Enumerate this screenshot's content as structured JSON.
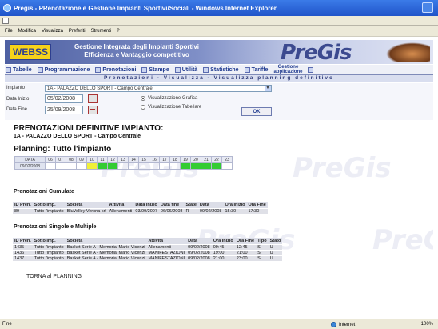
{
  "window": {
    "title": "Pregis - PRenotazione e Gestione Impianti Sportivi/Sociali - Windows Internet Explorer"
  },
  "menu": [
    "File",
    "Modifica",
    "Visualizza",
    "Preferiti",
    "Strumenti",
    "?"
  ],
  "banner": {
    "logo": "WEBSS",
    "line1": "Gestione Integrata degli Impianti Sportivi",
    "line2": "Efficienza e Vantaggio competitivo",
    "brand": "PreGis"
  },
  "toolbar": {
    "items": [
      "Tabelle",
      "Programmazione",
      "Prenotazioni",
      "Stampe",
      "Utilità",
      "Statistiche",
      "Tariffe"
    ],
    "gestione_line1": "Gestione",
    "gestione_line2": "applicazione"
  },
  "subtitle": "Prenotazioni - Visualizza - Visualizza planning definitivo",
  "form": {
    "impianto_label": "Impianto",
    "impianto_value": "1A - PALAZZO DELLO SPORT - Campo Centrale",
    "data_inizio_label": "Data Inizio",
    "data_inizio_value": "05/02/2008",
    "data_fine_label": "Data Fine",
    "data_fine_value": "25/09/2008",
    "radio_grafica": "Visualizzazione Grafica",
    "radio_tabellare": "Visualizzazione Tabellare",
    "ok": "OK"
  },
  "pane": {
    "title": "PRENOTAZIONI DEFINITIVE IMPIANTO:",
    "subtitle": "1A - PALAZZO DELLO SPORT - Campo Centrale",
    "planning_title": "Planning: Tutto l'impianto",
    "planning_label_header": "DATA",
    "planning_date": "09/02/2008",
    "hours": [
      "06",
      "07",
      "08",
      "09",
      "10",
      "11",
      "12",
      "13",
      "14",
      "15",
      "16",
      "17",
      "18",
      "19",
      "20",
      "21",
      "22",
      "23"
    ],
    "cell_states": [
      "",
      "",
      "",
      "",
      "y",
      "g",
      "g",
      "",
      "",
      "",
      "",
      "",
      "",
      "g",
      "g",
      "g",
      "g",
      ""
    ]
  },
  "cumulate": {
    "title": "Prenotazioni Cumulate",
    "headers": [
      "ID Pren.",
      "Sotto Imp.",
      "Società",
      "Attività",
      "Data inizio",
      "Data fine",
      "State",
      "Data",
      "Ora Inizio",
      "Ora Fine"
    ],
    "rows": [
      [
        "89",
        "Tutto l'impianto",
        "BluVolley Verona srl",
        "Allenamenti",
        "03/09/2007",
        "06/06/2008",
        "R",
        "09/02/2008",
        "15:30",
        "17:30"
      ]
    ]
  },
  "singole": {
    "title": "Prenotazioni Singole e Multiple",
    "headers": [
      "ID Pren.",
      "Sotto Imp.",
      "Società",
      "Attività",
      "Data",
      "Ora Inizio",
      "Ora Fine",
      "Tipo",
      "Stato"
    ],
    "rows": [
      [
        "1435",
        "Tutto l'impianto",
        "Basket Serie A - Memorial Mario Vicenzi",
        "Allenamenti",
        "09/02/2008",
        "09:45",
        "12:45",
        "S",
        "U"
      ],
      [
        "1436",
        "Tutto l'impianto",
        "Basket Serie A - Memorial Mario Vicenzi",
        "MANIFESTAZIONI",
        "09/02/2008",
        "19:00",
        "21:00",
        "S",
        "U"
      ],
      [
        "1437",
        "Tutto l'impianto",
        "Basket Serie A - Memorial Mario Vicenzi",
        "MANIFESTAZIONI",
        "09/02/2008",
        "21:00",
        "23:00",
        "S",
        "U"
      ]
    ]
  },
  "torna": "TORNA al PLANNING",
  "status": {
    "left": "Fine",
    "zone": "Internet",
    "zoom": "100%"
  },
  "colors": {
    "accent": "#1f54c9",
    "banner": "#4e60a2",
    "reserved_yellow": "#f0f039",
    "reserved_green": "#33cc33"
  }
}
